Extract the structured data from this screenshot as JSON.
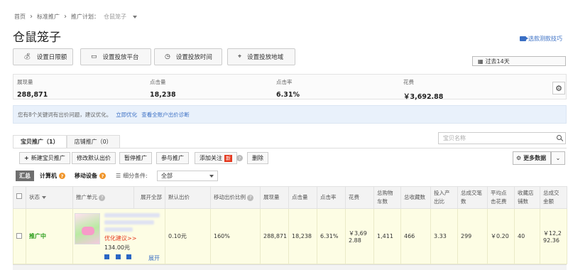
{
  "breadcrumb": {
    "home": "首页",
    "section": "标准推广",
    "plan_label": "推广计划：",
    "plan_name": "仓鼠笼子"
  },
  "page_title": "仓鼠笼子",
  "video_link": "选款测款技巧",
  "set_buttons": [
    "设置日限额",
    "设置投放平台",
    "设置投放时间",
    "设置投放地域"
  ],
  "period": "过去14天",
  "stats": [
    {
      "label": "展现量",
      "value": "288,871"
    },
    {
      "label": "点击量",
      "value": "18,238"
    },
    {
      "label": "点击率",
      "value": "6.31%"
    },
    {
      "label": "花费",
      "value": "￥3,692.88"
    }
  ],
  "notice": {
    "text": "您有8个关键词有出价问题，建议优化。",
    "link1": "立即优化",
    "link2": "查看全账户出价诊断"
  },
  "tabs": [
    "宝贝推广（1）",
    "店铺推广（0）"
  ],
  "search_placeholder": "宝贝名称",
  "toolbar": {
    "new": "新建宝贝推广",
    "edit_bid": "修改默认出价",
    "pause": "暂停推广",
    "join": "参与推广",
    "follow": "添加关注",
    "new_badge": "新",
    "delete": "删除",
    "more": "更多数据"
  },
  "filters": {
    "summary": "汇总",
    "computer": "计算机",
    "mobile": "移动设备",
    "seg_label": "细分条件:",
    "seg_value": "全部"
  },
  "table": {
    "headers": [
      "状态",
      "推广单元",
      "展开全部",
      "默认出价",
      "移动出价比例",
      "展现量",
      "点击量",
      "点击率",
      "花费",
      "总购物车数",
      "总收藏数",
      "投入产出比",
      "总成交笔数",
      "平均点击花费",
      "收藏店铺数",
      "总成交金额"
    ],
    "row": {
      "status": "推广中",
      "suggest": "优化建议>>",
      "price": "134.00元",
      "expand": "展开",
      "bid": "0.10元",
      "mobile_ratio": "160%",
      "impressions": "288,871",
      "clicks": "18,238",
      "ctr": "6.31%",
      "cost": "￥3,692.88",
      "cart": "1,411",
      "fav": "466",
      "roi": "3.33",
      "orders": "299",
      "cpc": "￥0.20",
      "shop_fav": "40",
      "gmv": "￥12,292.36"
    }
  },
  "colors": {
    "accent": "#3a6fc4",
    "status_green": "#2a9d1a",
    "alert_red": "#e53a20",
    "row_highlight": "#fdfde4"
  }
}
